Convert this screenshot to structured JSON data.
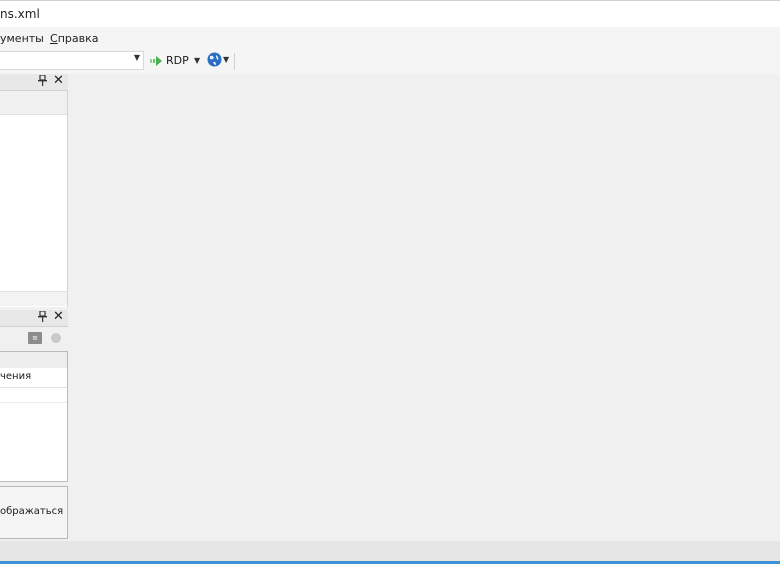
{
  "window": {
    "title": "ns.xml"
  },
  "menu": {
    "items": [
      {
        "label": "ументы"
      },
      {
        "label": "Справка"
      }
    ]
  },
  "toolbar": {
    "address_value": "",
    "connect_label": "RDP",
    "icons": [
      "arrow-right-icon",
      "chevron-down-icon",
      "globe-icon"
    ]
  },
  "connections_panel": {
    "icons": [
      "pin-icon",
      "close-icon"
    ]
  },
  "config_panel": {
    "icons": [
      "pin-icon",
      "close-icon",
      "sort-icon",
      "circle-icon"
    ],
    "grid_row_text": "чения",
    "description_text": "ображаться в"
  },
  "colors": {
    "accent": "#3d8fd6",
    "rdp_arrow": "#4caf50",
    "globe": "#2a6fc4"
  }
}
